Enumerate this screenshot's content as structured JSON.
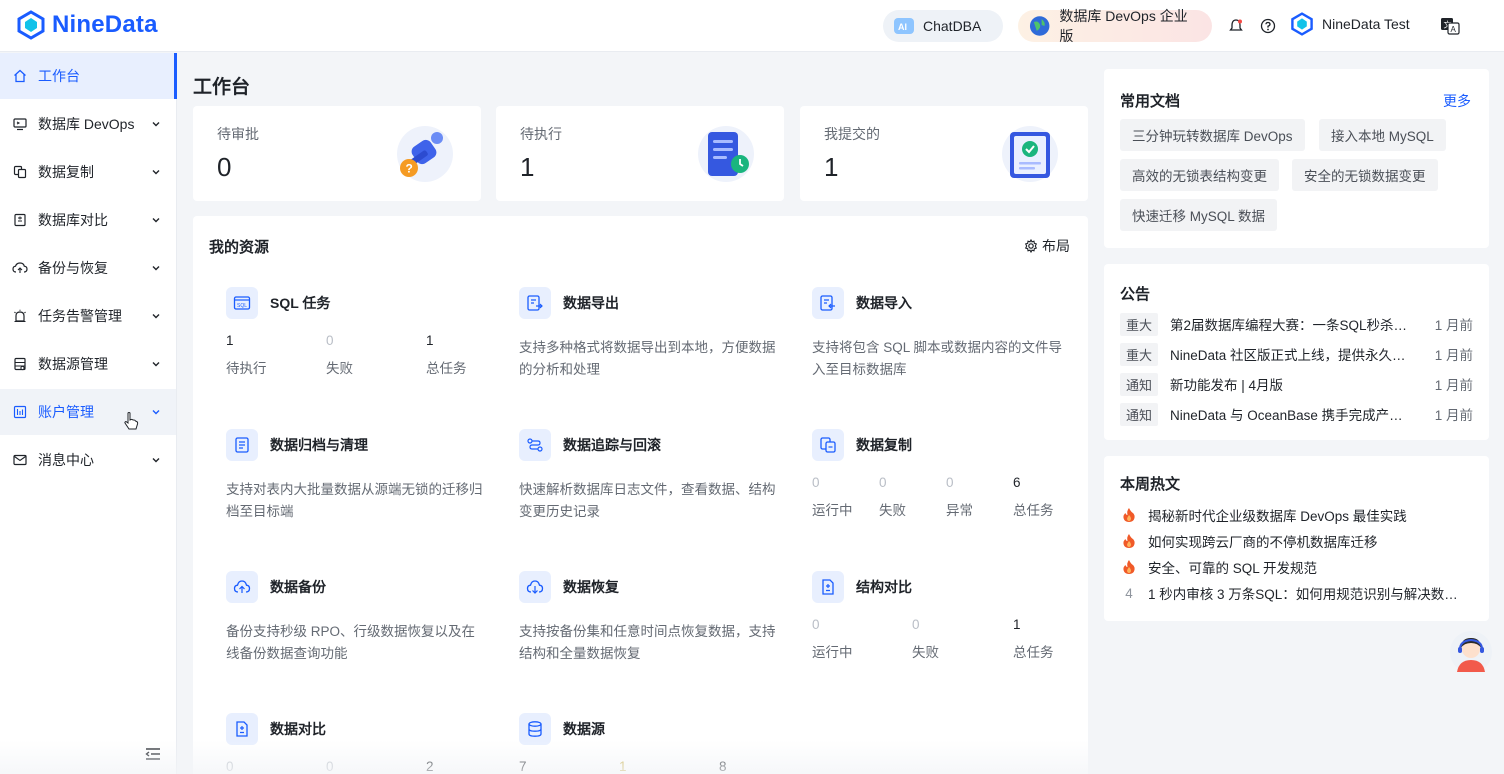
{
  "brand": {
    "name": "NineData",
    "accent": "#1a5cff"
  },
  "header": {
    "chatdba_label": "ChatDBA",
    "edition_label": "数据库 DevOps 企业版",
    "user_name": "NineData Test"
  },
  "sidebar": {
    "items": [
      {
        "label": "工作台",
        "icon": "home-icon",
        "active": true
      },
      {
        "label": "数据库 DevOps",
        "icon": "monitor-icon"
      },
      {
        "label": "数据复制",
        "icon": "copy-icon"
      },
      {
        "label": "数据库对比",
        "icon": "compare-icon"
      },
      {
        "label": "备份与恢复",
        "icon": "cloud-backup-icon"
      },
      {
        "label": "任务告警管理",
        "icon": "alarm-icon"
      },
      {
        "label": "数据源管理",
        "icon": "datasource-icon"
      },
      {
        "label": "账户管理",
        "icon": "account-icon"
      },
      {
        "label": "消息中心",
        "icon": "mail-icon"
      }
    ]
  },
  "main": {
    "title": "工作台",
    "stats": [
      {
        "label": "待审批",
        "value": "0"
      },
      {
        "label": "待执行",
        "value": "1"
      },
      {
        "label": "我提交的",
        "value": "1"
      }
    ],
    "resources": {
      "title": "我的资源",
      "layout_label": "布局",
      "items": [
        {
          "name": "SQL 任务",
          "stats": [
            {
              "n": "1",
              "t": "待执行"
            },
            {
              "n": "0",
              "t": "失败"
            },
            {
              "n": "1",
              "t": "总任务"
            }
          ]
        },
        {
          "name": "数据导出",
          "desc": "支持多种格式将数据导出到本地，方便数据的分析和处理"
        },
        {
          "name": "数据导入",
          "desc": "支持将包含 SQL 脚本或数据内容的文件导入至目标数据库"
        },
        {
          "name": "数据归档与清理",
          "desc": "支持对表内大批量数据从源端无锁的迁移归档至目标端"
        },
        {
          "name": "数据追踪与回滚",
          "desc": "快速解析数据库日志文件，查看数据、结构变更历史记录"
        },
        {
          "name": "数据复制",
          "stats": [
            {
              "n": "0",
              "t": "运行中"
            },
            {
              "n": "0",
              "t": "失败"
            },
            {
              "n": "0",
              "t": "异常"
            },
            {
              "n": "6",
              "t": "总任务"
            }
          ]
        },
        {
          "name": "数据备份",
          "desc": "备份支持秒级 RPO、行级数据恢复以及在线备份数据查询功能"
        },
        {
          "name": "数据恢复",
          "desc": "支持按备份集和任意时间点恢复数据，支持结构和全量数据恢复"
        },
        {
          "name": "结构对比",
          "stats": [
            {
              "n": "0",
              "t": "运行中"
            },
            {
              "n": "0",
              "t": "失败"
            },
            {
              "n": "1",
              "t": "总任务"
            }
          ]
        },
        {
          "name": "数据对比",
          "stats": [
            {
              "n": "0",
              "t": ""
            },
            {
              "n": "0",
              "t": ""
            },
            {
              "n": "2",
              "t": ""
            }
          ]
        },
        {
          "name": "数据源",
          "stats": [
            {
              "n": "7",
              "t": ""
            },
            {
              "n": "1",
              "t": ""
            },
            {
              "n": "8",
              "t": ""
            }
          ]
        }
      ]
    }
  },
  "right": {
    "docs": {
      "title": "常用文档",
      "more": "更多",
      "chips": [
        "三分钟玩转数据库 DevOps",
        "接入本地 MySQL",
        "高效的无锁表结构变更",
        "安全的无锁数据变更",
        "快速迁移 MySQL 数据"
      ]
    },
    "notices": {
      "title": "公告",
      "rows": [
        {
          "tag": "重大",
          "title": "第2届数据库编程大赛：一条SQL秒杀…",
          "time": "1 月前"
        },
        {
          "tag": "重大",
          "title": "NineData 社区版正式上线，提供永久…",
          "time": "1 月前"
        },
        {
          "tag": "通知",
          "title": "新功能发布 | 4月版",
          "time": "1 月前"
        },
        {
          "tag": "通知",
          "title": "NineData 与 OceanBase 携手完成产…",
          "time": "1 月前"
        }
      ]
    },
    "hot": {
      "title": "本周热文",
      "rows": [
        {
          "rank": "",
          "title": "揭秘新时代企业级数据库 DevOps 最佳实践"
        },
        {
          "rank": "",
          "title": "如何实现跨云厂商的不停机数据库迁移"
        },
        {
          "rank": "",
          "title": "安全、可靠的 SQL 开发规范"
        },
        {
          "rank": "4",
          "title": "1 秒内审核 3 万条SQL：如何用规范识别与解决数…"
        }
      ]
    }
  }
}
